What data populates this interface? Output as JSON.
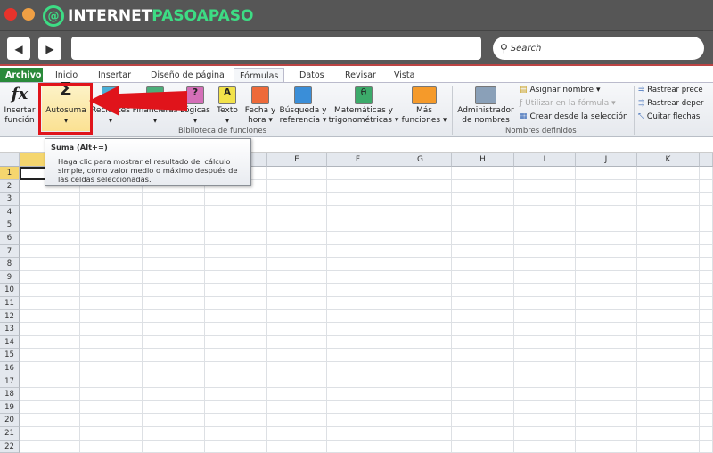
{
  "window": {
    "logo_prefix": "INTERNET",
    "logo_suffix": "PASOAPASO"
  },
  "nav": {
    "back": "◀",
    "forward": "▶",
    "address": "",
    "search_placeholder": "Search"
  },
  "tabs": [
    "Archivo",
    "Inicio",
    "Insertar",
    "Diseño de página",
    "Fórmulas",
    "Datos",
    "Revisar",
    "Vista"
  ],
  "active_tab": "Fórmulas",
  "ribbon": {
    "insertar_funcion": [
      "Insertar",
      "función"
    ],
    "autosuma": "Autosuma",
    "recientes": "Recientes",
    "financieras": "Financieras",
    "logicas": "Lógicas",
    "texto": "Texto",
    "fecha": [
      "Fecha y",
      "hora ▾"
    ],
    "busqueda": [
      "Búsqueda y",
      "referencia ▾"
    ],
    "matematicas": [
      "Matemáticas y",
      "trigonométricas ▾"
    ],
    "mas": [
      "Más",
      "funciones ▾"
    ],
    "group1": "Biblioteca de funciones",
    "administrador": [
      "Administrador",
      "de nombres"
    ],
    "asignar": "Asignar nombre ▾",
    "utilizar": "Utilizar en la fórmula ▾",
    "crear": "Crear desde la selección",
    "group2": "Nombres definidos",
    "rastrear_prec": "Rastrear prece",
    "rastrear_dep": "Rastrear deper",
    "quitar": "Quitar flechas"
  },
  "tooltip": {
    "title": "Suma (Alt+=)",
    "body": "Haga clic para mostrar el resultado del cálculo simple, como valor medio o máximo después de las celdas seleccionadas."
  },
  "sheet": {
    "columns": [
      "",
      "",
      "",
      "",
      "E",
      "F",
      "G",
      "H",
      "I",
      "J",
      "K",
      ""
    ],
    "rows": [
      "1",
      "2",
      "3",
      "4",
      "5",
      "6",
      "7",
      "8",
      "9",
      "10",
      "11",
      "12",
      "13",
      "14",
      "15",
      "16",
      "17",
      "18",
      "19",
      "20",
      "21",
      "22"
    ],
    "selected_cell": "A1"
  },
  "colors": {
    "accent_green": "#3ddc84",
    "archivo_tab": "#2a8a3a",
    "highlight": "#e0141b"
  }
}
